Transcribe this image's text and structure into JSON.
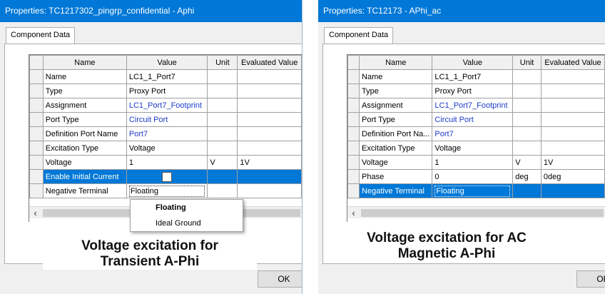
{
  "left": {
    "title": "Properties: TC1217302_pingrp_confidential - Aphi",
    "tab": "Component Data",
    "columns": [
      "Name",
      "Value",
      "Unit",
      "Evaluated Value"
    ],
    "rows": [
      {
        "name": "Name",
        "value": "LC1_1_Port7",
        "unit": "",
        "eval": ""
      },
      {
        "name": "Type",
        "value": "Proxy Port",
        "unit": "",
        "eval": ""
      },
      {
        "name": "Assignment",
        "value": "LC1_Port7_Footprint",
        "unit": "",
        "eval": ""
      },
      {
        "name": "Port Type",
        "value": "Circuit Port",
        "unit": "",
        "eval": ""
      },
      {
        "name": "Definition Port Name",
        "value": "Port7",
        "unit": "",
        "eval": ""
      },
      {
        "name": "Excitation Type",
        "value": "Voltage",
        "unit": "",
        "eval": ""
      },
      {
        "name": "Voltage",
        "value": "1",
        "unit": "V",
        "eval": "1V"
      },
      {
        "name": "Enable Initial Current",
        "value": "",
        "unit": "",
        "eval": ""
      },
      {
        "name": "Negative Terminal",
        "value": "Floating",
        "unit": "",
        "eval": ""
      }
    ],
    "scroll_left": "‹",
    "dropdown_options": [
      "Floating",
      "Ideal Ground"
    ],
    "caption": [
      "Voltage excitation for",
      "Transient A-Phi"
    ],
    "ok": "OK"
  },
  "right": {
    "title": "Properties: TC12173 - APhi_ac",
    "tab": "Component Data",
    "columns": [
      "Name",
      "Value",
      "Unit",
      "Evaluated Value"
    ],
    "rows": [
      {
        "name": "Name",
        "value": "LC1_1_Port7",
        "unit": "",
        "eval": ""
      },
      {
        "name": "Type",
        "value": "Proxy Port",
        "unit": "",
        "eval": ""
      },
      {
        "name": "Assignment",
        "value": "LC1_Port7_Footprint",
        "unit": "",
        "eval": ""
      },
      {
        "name": "Port Type",
        "value": "Circuit Port",
        "unit": "",
        "eval": ""
      },
      {
        "name": "Definition Port Na...",
        "value": "Port7",
        "unit": "",
        "eval": ""
      },
      {
        "name": "Excitation Type",
        "value": "Voltage",
        "unit": "",
        "eval": ""
      },
      {
        "name": "Voltage",
        "value": "1",
        "unit": "V",
        "eval": "1V"
      },
      {
        "name": "Phase",
        "value": "0",
        "unit": "deg",
        "eval": "0deg"
      },
      {
        "name": "Negative Terminal",
        "value": "Floating",
        "unit": "",
        "eval": ""
      }
    ],
    "scroll_left": "‹",
    "caption": [
      "Voltage excitation for AC",
      "Magnetic A-Phi"
    ],
    "ok": "OK"
  }
}
